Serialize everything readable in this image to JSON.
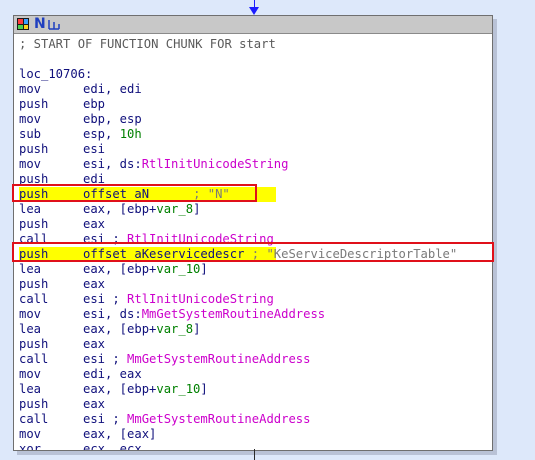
{
  "window": {
    "title_n": "N",
    "title_sub_icon": "subroutine-icon",
    "grid_icon": "graph-overview-icon"
  },
  "colors": {
    "background": "#dde8fa",
    "node_bg": "#ffffff",
    "mnemonic": "#10107c",
    "function_name": "#cc00cc",
    "variable": "#008000",
    "comment_string": "#7a7a7a",
    "highlight": "#ffff00",
    "annotation_box": "#e0101a",
    "edge_arrow": "#1c1cff"
  },
  "code": {
    "header_comment": "; START OF FUNCTION CHUNK FOR start",
    "label": "loc_10706:",
    "lines": [
      {
        "mnemonic": "mov",
        "operand": "edi, edi"
      },
      {
        "mnemonic": "push",
        "operand": "ebp"
      },
      {
        "mnemonic": "mov",
        "operand": "ebp, esp"
      },
      {
        "mnemonic": "sub",
        "operand_prefix": "esp, ",
        "operand_num": "10h"
      },
      {
        "mnemonic": "push",
        "operand": "esi"
      },
      {
        "mnemonic": "mov",
        "operand_prefix": "esi, ds:",
        "operand_func": "RtlInitUnicodeString"
      },
      {
        "mnemonic": "push",
        "operand": "edi"
      },
      {
        "mnemonic": "push",
        "operand_prefix": "offset aN",
        "comment": "; \"N\"",
        "highlighted": true
      },
      {
        "mnemonic": "lea",
        "operand_prefix": "eax, [ebp+",
        "operand_var": "var_8",
        "operand_suffix": "]"
      },
      {
        "mnemonic": "push",
        "operand": "eax"
      },
      {
        "mnemonic": "call",
        "operand_prefix": "esi ; ",
        "operand_func": "RtlInitUnicodeString"
      },
      {
        "mnemonic": "push",
        "operand_prefix": "offset aKeservicedescr",
        "comment": "; \"KeServiceDescriptorTable\"",
        "highlighted": true
      },
      {
        "mnemonic": "lea",
        "operand_prefix": "eax, [ebp+",
        "operand_var": "var_10",
        "operand_suffix": "]"
      },
      {
        "mnemonic": "push",
        "operand": "eax"
      },
      {
        "mnemonic": "call",
        "operand_prefix": "esi ; ",
        "operand_func": "RtlInitUnicodeString"
      },
      {
        "mnemonic": "mov",
        "operand_prefix": "esi, ds:",
        "operand_func": "MmGetSystemRoutineAddress"
      },
      {
        "mnemonic": "lea",
        "operand_prefix": "eax, [ebp+",
        "operand_var": "var_8",
        "operand_suffix": "]"
      },
      {
        "mnemonic": "push",
        "operand": "eax"
      },
      {
        "mnemonic": "call",
        "operand_prefix": "esi ; ",
        "operand_func": "MmGetSystemRoutineAddress"
      },
      {
        "mnemonic": "mov",
        "operand": "edi, eax"
      },
      {
        "mnemonic": "lea",
        "operand_prefix": "eax, [ebp+",
        "operand_var": "var_10",
        "operand_suffix": "]"
      },
      {
        "mnemonic": "push",
        "operand": "eax"
      },
      {
        "mnemonic": "call",
        "operand_prefix": "esi ; ",
        "operand_func": "MmGetSystemRoutineAddress"
      },
      {
        "mnemonic": "mov",
        "operand": "eax, [eax]"
      },
      {
        "mnemonic": "xor",
        "operand": "ecx, ecx"
      }
    ]
  }
}
